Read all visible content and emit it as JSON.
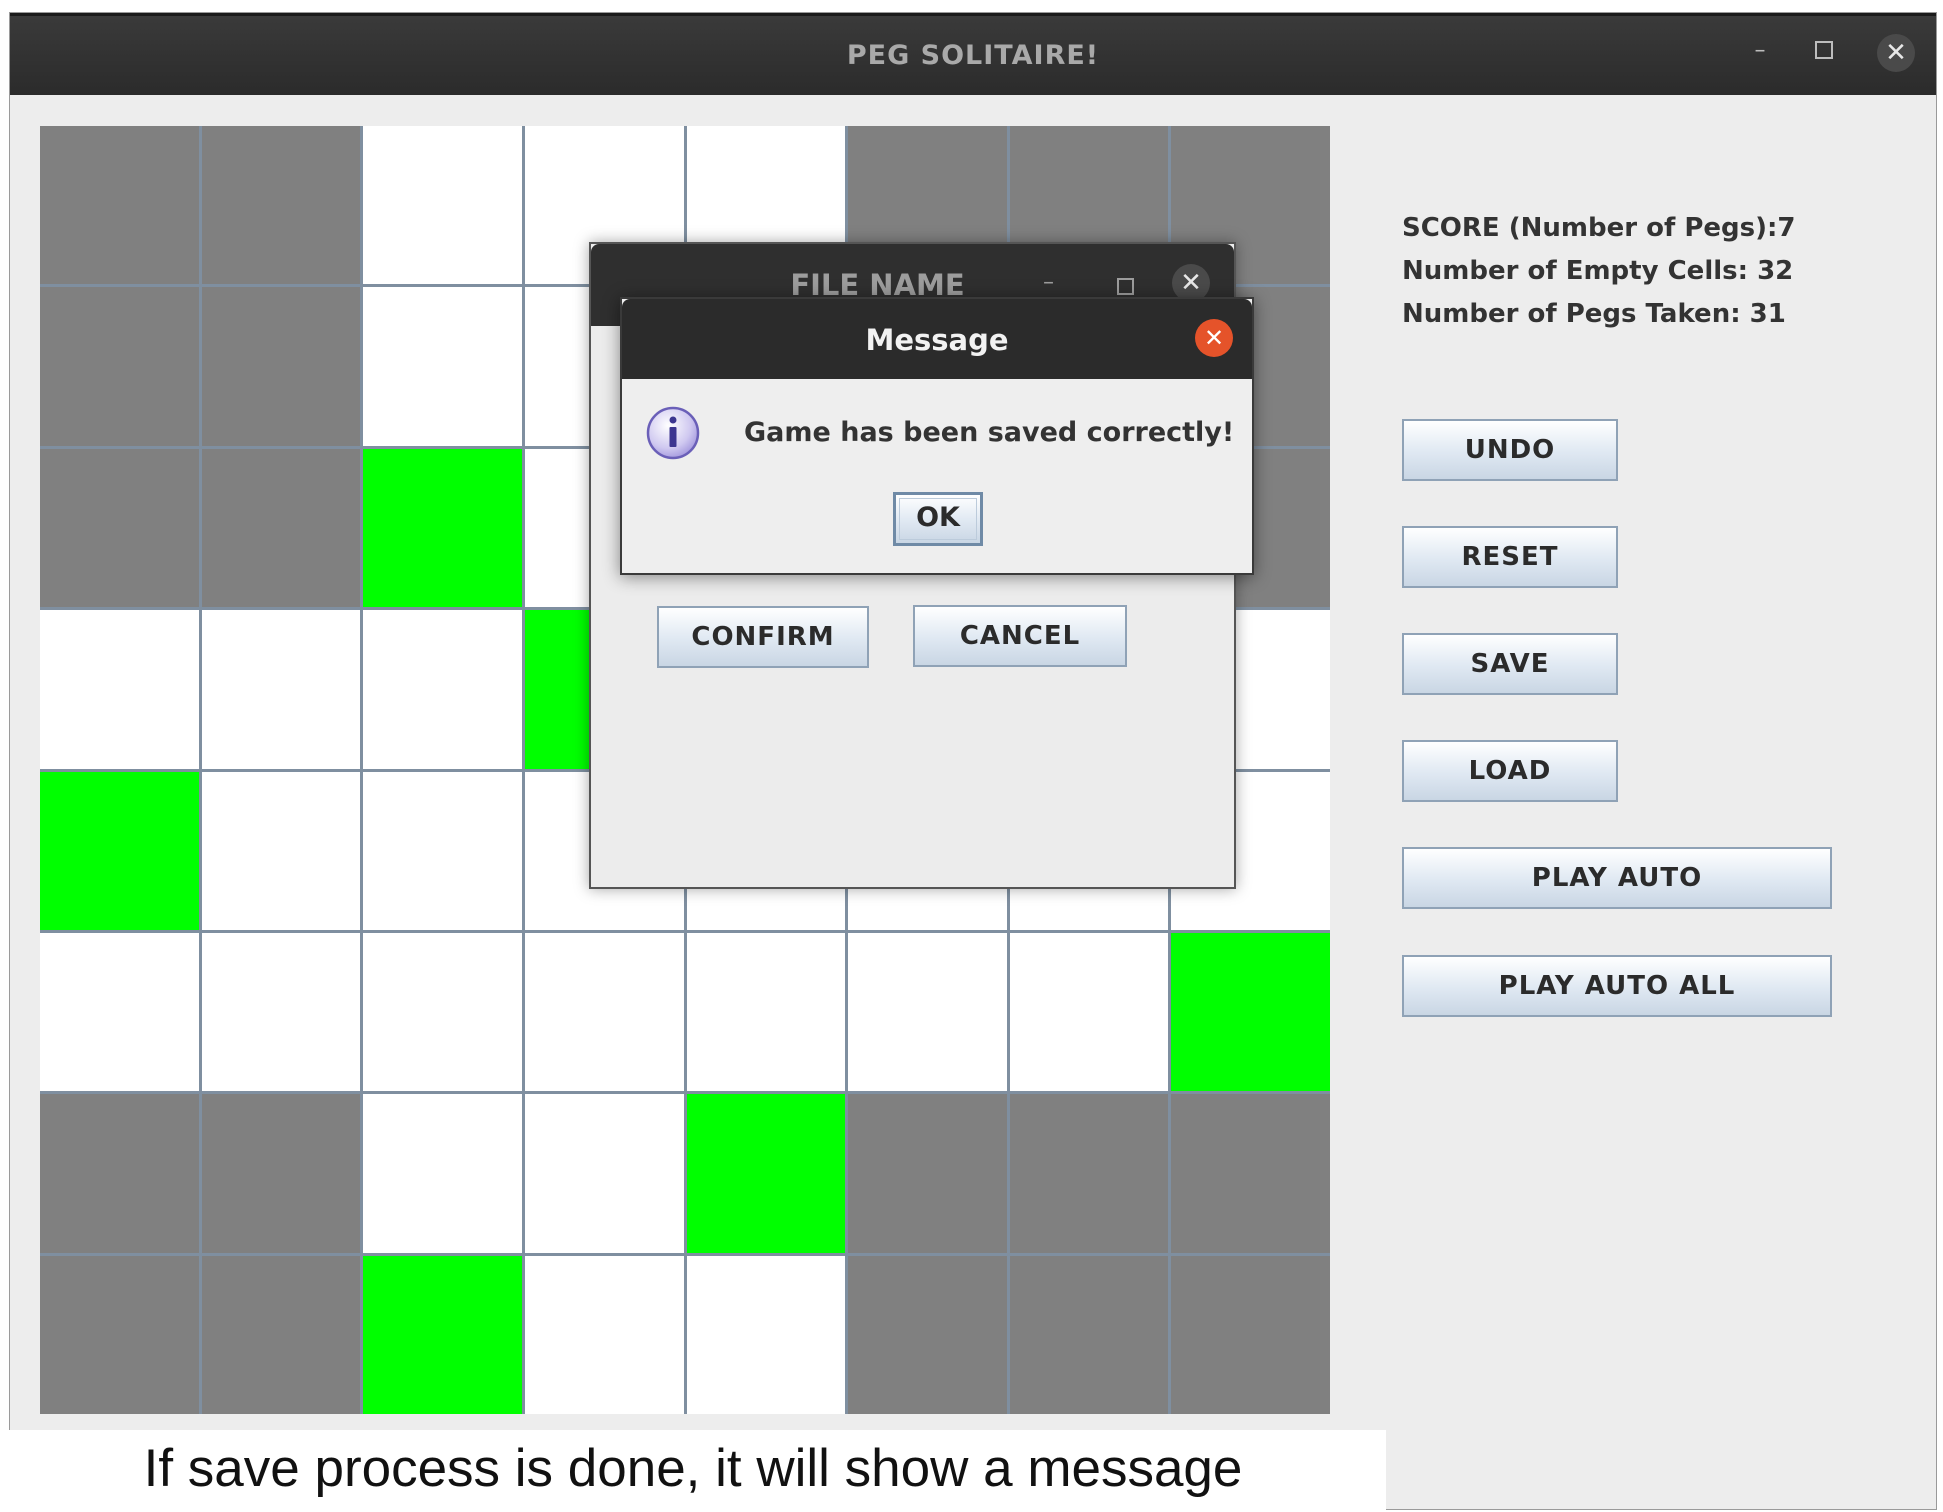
{
  "window": {
    "title": "PEG SOLITAIRE!",
    "controls": {
      "minimize": "–",
      "maximize": "",
      "close": "✕"
    }
  },
  "board": {
    "rows": [
      [
        "invalid",
        "invalid",
        "empty",
        "empty",
        "empty",
        "invalid",
        "invalid",
        "invalid"
      ],
      [
        "invalid",
        "invalid",
        "empty",
        "empty",
        "empty",
        "invalid",
        "invalid",
        "invalid"
      ],
      [
        "invalid",
        "invalid",
        "peg",
        "empty",
        "empty",
        "invalid",
        "invalid",
        "invalid"
      ],
      [
        "empty",
        "empty",
        "empty",
        "peg",
        "empty",
        "empty",
        "empty",
        "empty"
      ],
      [
        "peg",
        "empty",
        "empty",
        "empty",
        "empty",
        "empty",
        "empty",
        "empty"
      ],
      [
        "empty",
        "empty",
        "empty",
        "empty",
        "empty",
        "empty",
        "empty",
        "peg"
      ],
      [
        "invalid",
        "invalid",
        "empty",
        "empty",
        "peg",
        "invalid",
        "invalid",
        "invalid"
      ],
      [
        "invalid",
        "invalid",
        "peg",
        "empty",
        "empty",
        "invalid",
        "invalid",
        "invalid"
      ]
    ],
    "colors": {
      "peg": "#00ff00",
      "empty": "#ffffff",
      "invalid": "#808080",
      "grid": "#7f8fa0"
    }
  },
  "stats": {
    "score": "SCORE (Number of Pegs):7",
    "empty_cells": "Number of Empty Cells: 32",
    "pegs_taken": "Number of Pegs Taken: 31"
  },
  "buttons": {
    "undo": "UNDO",
    "reset": "RESET",
    "save": "SAVE",
    "load": "LOAD",
    "play_auto": "PLAY AUTO",
    "play_auto_all": "PLAY AUTO ALL"
  },
  "file_dialog": {
    "title": "FILE NAME",
    "minimize": "–",
    "close": "✕",
    "confirm": "CONFIRM",
    "cancel": "CANCEL"
  },
  "message_dialog": {
    "title": "Message",
    "close": "✕",
    "icon": "info-icon",
    "text": "Game has been saved correctly!",
    "ok": "OK"
  },
  "caption": "If save process is done, it will show a message"
}
